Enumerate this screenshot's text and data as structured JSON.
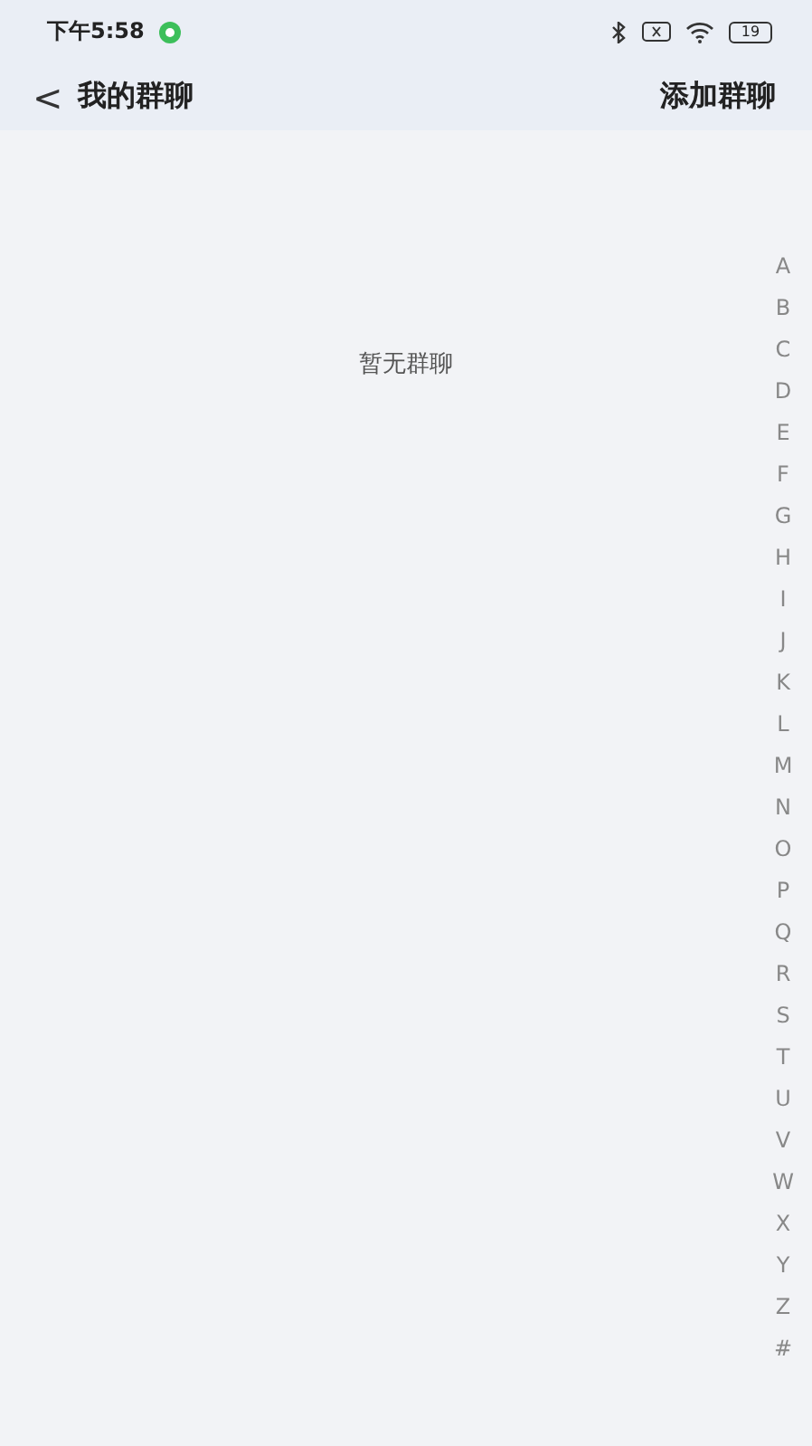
{
  "status_bar": {
    "time": "下午5:58",
    "battery": "19"
  },
  "header": {
    "back": "<",
    "title": "我的群聊",
    "action": "添加群聊"
  },
  "empty_message": "暂无群聊",
  "index_letters": [
    "A",
    "B",
    "C",
    "D",
    "E",
    "F",
    "G",
    "H",
    "I",
    "J",
    "K",
    "L",
    "M",
    "N",
    "O",
    "P",
    "Q",
    "R",
    "S",
    "T",
    "U",
    "V",
    "W",
    "X",
    "Y",
    "Z",
    "#"
  ]
}
